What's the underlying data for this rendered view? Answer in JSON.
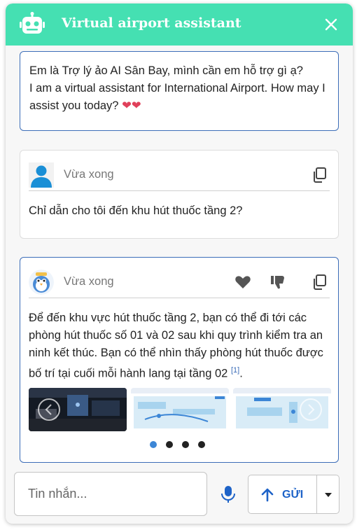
{
  "header": {
    "title": "Virtual airport assistant",
    "bg_color": "#45e0b2",
    "logo_icon": "robot-icon",
    "close_icon": "close-icon"
  },
  "greeting": {
    "text": "Em là Trợ lý ảo AI Sân Bay, mình cần em hỗ trợ gì ạ?\nI am a virtual assistant for International Airport. How may I assist you today?",
    "hearts": "❤❤"
  },
  "user_message": {
    "timestamp": "Vừa xong",
    "text": "Chỉ dẫn cho tôi đến khu hút thuốc tầng 2?",
    "avatar_icon": "user-avatar-icon",
    "copy_icon": "copy-icon"
  },
  "bot_message": {
    "timestamp": "Vừa xong",
    "text": "Để đến khu vực hút thuốc tầng 2, bạn có thể đi tới các phòng hút thuốc số 01 và 02 sau khi quy trình kiểm tra an ninh kết thúc. Bạn có thể nhìn thấy phòng hút thuốc được bố trí tại cuối mỗi hành lang tại tầng 02",
    "citation": "[1]",
    "avatar_icon": "bird-mascot-icon",
    "actions": [
      "like-icon",
      "dislike-icon",
      "copy-icon"
    ],
    "carousel": {
      "images": [
        "terminal-photo",
        "floor-map-1",
        "floor-map-2"
      ],
      "page_count": 4,
      "active_page": 1
    }
  },
  "composer": {
    "placeholder": "Tin nhắn...",
    "send_label": "GỬI",
    "mic_icon": "microphone-icon",
    "dropdown_icon": "caret-down-icon"
  },
  "colors": {
    "accent": "#45e0b2",
    "border_active": "#3c6db8",
    "send_text": "#1e63c8"
  }
}
